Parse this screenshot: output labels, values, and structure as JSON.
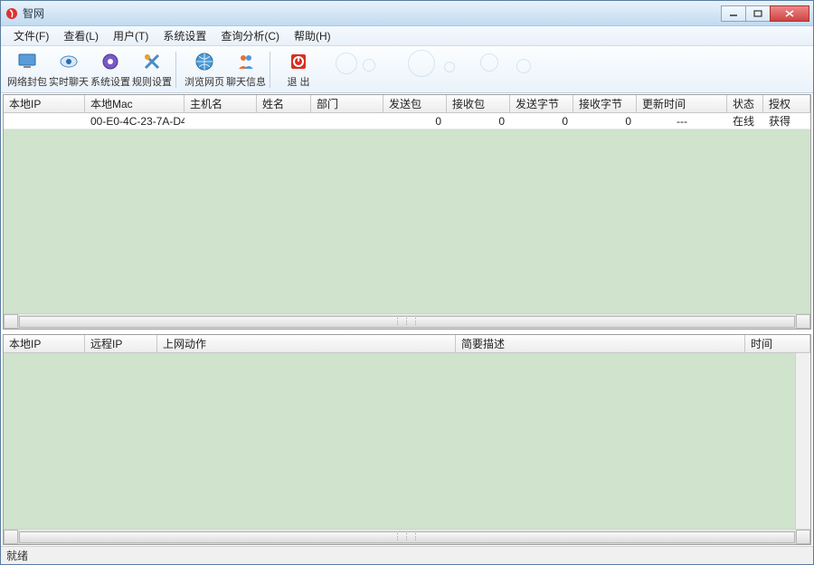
{
  "window": {
    "title": "智网"
  },
  "menu": {
    "file": "文件(F)",
    "view": "查看(L)",
    "user": "用户(T)",
    "sys": "系统设置",
    "query": "查询分析(C)",
    "help": "帮助(H)"
  },
  "toolbar": {
    "netblock": "网络封包",
    "chat": "实时聊天",
    "settings": "系统设置",
    "rules": "规则设置",
    "browse": "浏览网页",
    "chatinfo": "聊天信息",
    "exit": "退 出"
  },
  "topCols": {
    "localIp": "本地IP",
    "localMac": "本地Mac",
    "host": "主机名",
    "name": "姓名",
    "dept": "部门",
    "sendPkt": "发送包",
    "recvPkt": "接收包",
    "sendBytes": "发送字节",
    "recvBytes": "接收字节",
    "updated": "更新时间",
    "status": "状态",
    "auth": "授权"
  },
  "topRow": {
    "localIp": "",
    "localMac": "00-E0-4C-23-7A-D4",
    "host": "",
    "name": "",
    "dept": "",
    "sendPkt": "0",
    "recvPkt": "0",
    "sendBytes": "0",
    "recvBytes": "0",
    "updated": "---",
    "status": "在线",
    "auth": "获得"
  },
  "bottomCols": {
    "localIp": "本地IP",
    "remoteIp": "远程IP",
    "action": "上网动作",
    "desc": "简要描述",
    "time": "时间"
  },
  "status": {
    "ready": "就绪"
  }
}
